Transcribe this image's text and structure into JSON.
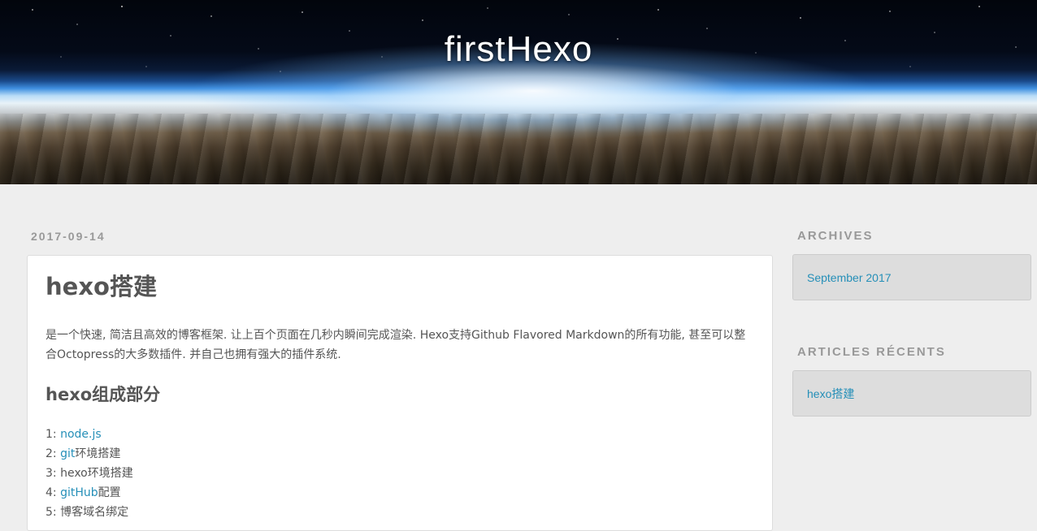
{
  "header": {
    "site_title": "firstHexo"
  },
  "post": {
    "date": "2017-09-14",
    "title": "hexo搭建",
    "intro": "是一个快速, 简洁且高效的博客框架. 让上百个页面在几秒内瞬间完成渲染. Hexo支持Github Flavored Markdown的所有功能, 甚至可以整合Octopress的大多数插件. 并自己也拥有强大的插件系统.",
    "section_heading": "hexo组成部分",
    "steps": [
      {
        "num": "1: ",
        "link": "node.js",
        "rest": ""
      },
      {
        "num": "2: ",
        "link": "git",
        "rest": "环境搭建"
      },
      {
        "num": "3: ",
        "link": "",
        "rest": "hexo环境搭建"
      },
      {
        "num": "4: ",
        "link": "gitHub",
        "rest": "配置"
      },
      {
        "num": "5: ",
        "link": "",
        "rest": "博客域名绑定"
      }
    ]
  },
  "sidebar": {
    "archives": {
      "title": "ARCHIVES",
      "link": "September 2017"
    },
    "recent": {
      "title": "ARTICLES RÉCENTS",
      "link": "hexo搭建"
    }
  },
  "colors": {
    "link": "#258fb8",
    "muted_heading": "#999999",
    "background": "#eeeeee"
  }
}
